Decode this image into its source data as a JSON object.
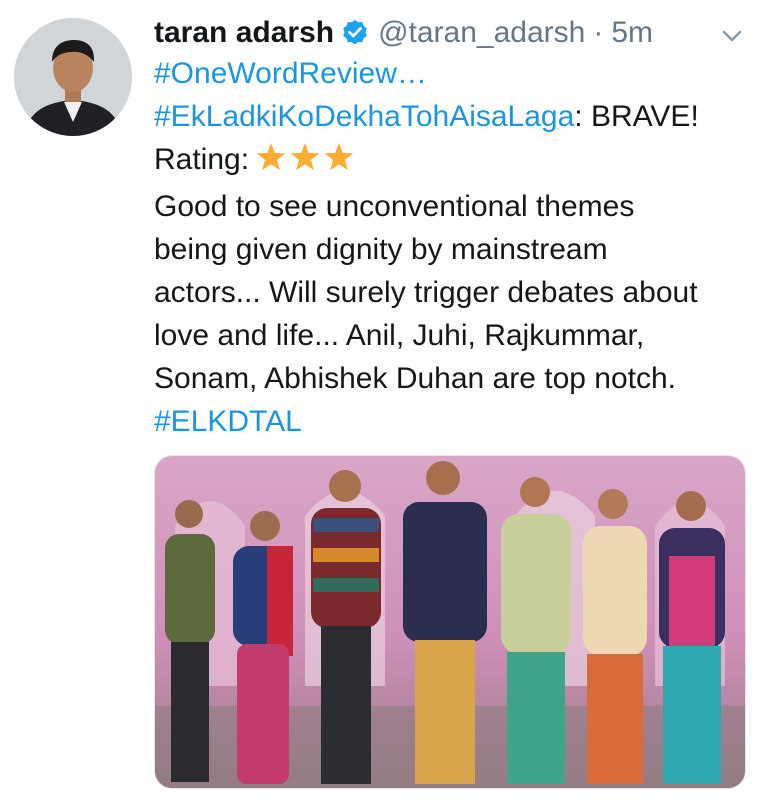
{
  "tweet": {
    "author_name": "taran adarsh",
    "handle": "@taran_adarsh",
    "separator": "·",
    "timestamp": "5m",
    "verified_icon": "verified-badge-icon",
    "more_icon": "chevron-down-icon",
    "hashtag_review": "#OneWordReview…",
    "hashtag_movie": "#EkLadkiKoDekhaTohAisaLaga",
    "verdict": ": BRAVE!",
    "rating_label": "Rating:",
    "rating_stars": 3,
    "body_lines": [
      "Good to see unconventional themes",
      "being given dignity by mainstream",
      "actors... Will surely trigger debates about",
      "love and life... Anil, Juhi, Rajkummar,",
      "Sonam, Abhishek Duhan are top notch."
    ],
    "hashtag_short": "#ELKDTAL",
    "media_icon": "movie-cast-photo"
  },
  "colors": {
    "link": "#1b95e0",
    "verified": "#1da1f2",
    "star": "#ffac33",
    "muted": "#657786"
  }
}
